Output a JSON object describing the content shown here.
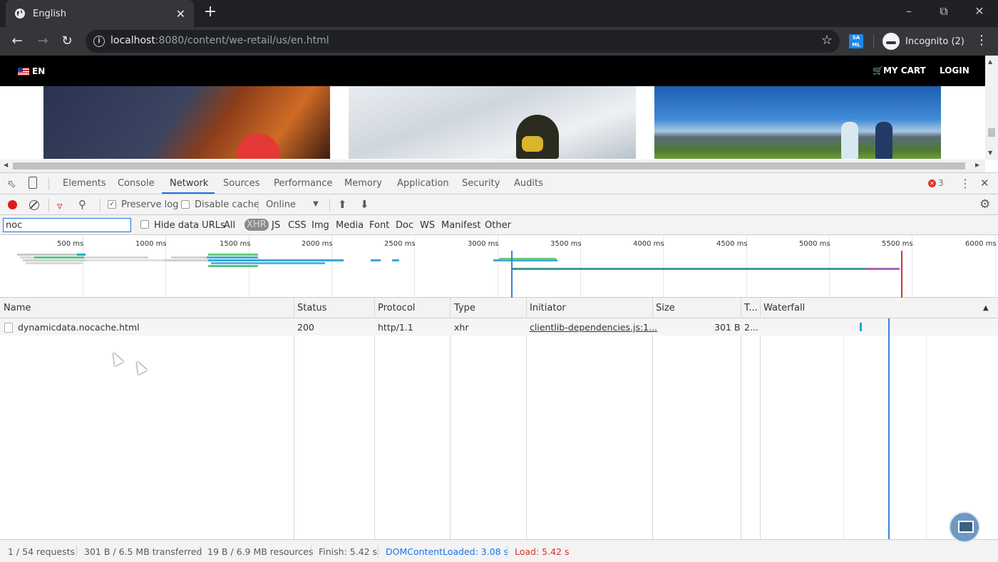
{
  "browser": {
    "tab_title": "English",
    "new_tab": "+",
    "close_tab": "✕",
    "url_host": "localhost",
    "url_rest": ":8080/content/we-retail/us/en.html",
    "profile": "Incognito (2)",
    "extension_label": "SA ML"
  },
  "site": {
    "lang": "EN",
    "cart": "MY CART",
    "login": "LOGIN"
  },
  "devtools": {
    "tabs": [
      "Elements",
      "Console",
      "Network",
      "Sources",
      "Performance",
      "Memory",
      "Application",
      "Security",
      "Audits"
    ],
    "active_tab": "Network",
    "error_count": "3",
    "toolbar": {
      "preserve_log": "Preserve log",
      "preserve_log_checked": true,
      "disable_cache": "Disable cache",
      "throttle": "Online"
    },
    "filter": {
      "value": "noc",
      "hide_data_urls": "Hide data URLs",
      "types": [
        "All",
        "XHR",
        "JS",
        "CSS",
        "Img",
        "Media",
        "Font",
        "Doc",
        "WS",
        "Manifest",
        "Other"
      ],
      "selected_type": "XHR"
    },
    "overview_ticks": [
      "500 ms",
      "1000 ms",
      "1500 ms",
      "2000 ms",
      "2500 ms",
      "3000 ms",
      "3500 ms",
      "4000 ms",
      "4500 ms",
      "5000 ms",
      "5500 ms",
      "6000 ms"
    ],
    "columns": [
      "Name",
      "Status",
      "Protocol",
      "Type",
      "Initiator",
      "Size",
      "T...",
      "Waterfall"
    ],
    "rows": [
      {
        "name": "dynamicdata.nocache.html",
        "status": "200",
        "protocol": "http/1.1",
        "type": "xhr",
        "initiator": "clientlib-dependencies.js:1...",
        "size": "301 B",
        "time": "2..."
      }
    ],
    "status": {
      "requests": "1 / 54 requests",
      "transferred": "301 B / 6.5 MB transferred",
      "resources": "19 B / 6.9 MB resources",
      "finish": "Finish: 5.42 s",
      "dcl": "DOMContentLoaded: 3.08 s",
      "load": "Load: 5.42 s"
    },
    "colors": {
      "dcl": "#1a73e8",
      "load": "#d93025",
      "selected_tab": "#1a73e8"
    }
  }
}
